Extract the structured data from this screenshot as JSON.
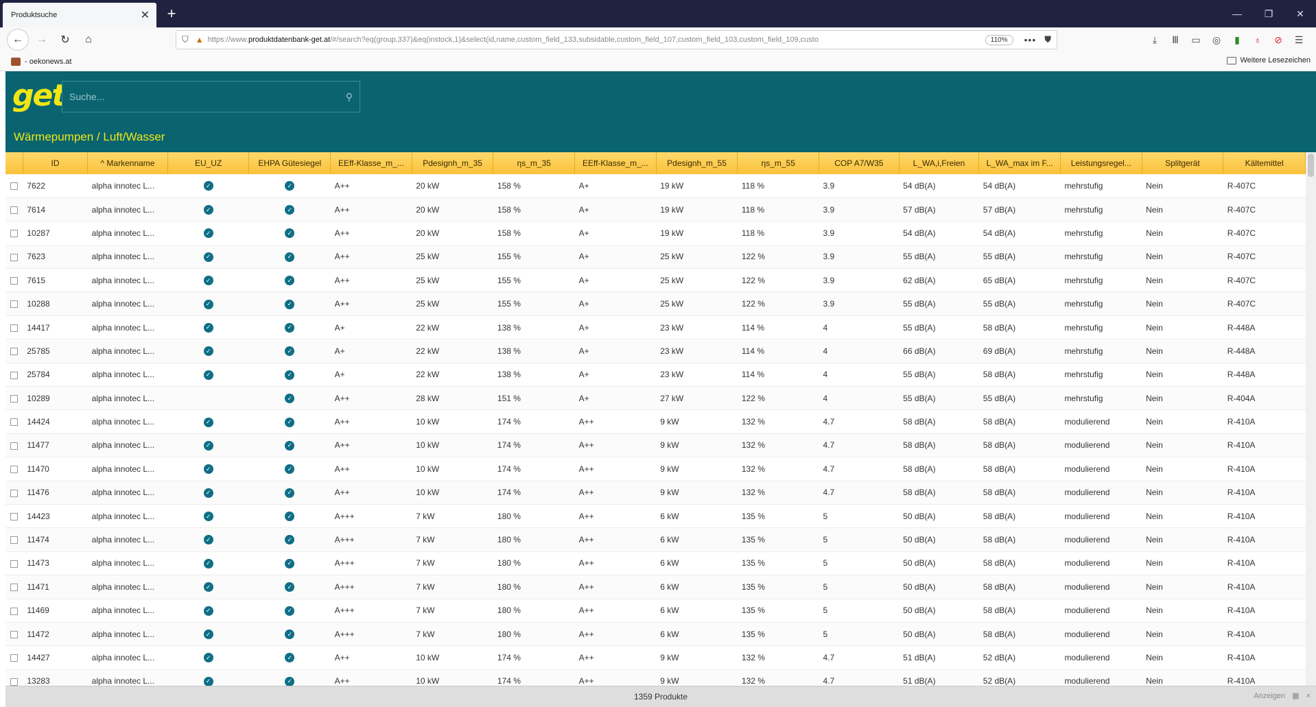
{
  "browser": {
    "tab_title": "Produktsuche",
    "tab_close": "✕",
    "new_tab": "+",
    "window_controls": [
      "—",
      "❐",
      "✕"
    ],
    "url_prefix": "https://www.",
    "url_domain": "produktdatenbank-get.at",
    "url_rest": "/#/search?eq(group,337)&eq(instock,1)&select(id,name,custom_field_133,subsidable,custom_field_107,custom_field_103,custom_field_109,custo",
    "zoom": "110%",
    "more": "•••",
    "bookmark_left": "- oekonews.at",
    "bookmark_right": "Weitere Lesezeichen"
  },
  "app": {
    "logo": "get",
    "search_placeholder": "Suche...",
    "breadcrumb": "Wärmepumpen / Luft/Wasser"
  },
  "table": {
    "columns": [
      "ID",
      "^ Markenname",
      "EU_UZ",
      "EHPA Gütesiegel",
      "EEff-Klasse_m_...",
      "Pdesignh_m_35",
      "ηs_m_35",
      "EEff-Klasse_m_...",
      "Pdesignh_m_55",
      "ηs_m_55",
      "COP A7/W35",
      "L_WA,i,Freien",
      "L_WA_max im F...",
      "Leistungsregel...",
      "Splitgerät",
      "Kältemittel"
    ],
    "rows": [
      {
        "id": "7622",
        "brand": "alpha innotec L...",
        "eu_uz": true,
        "ehpa": true,
        "eff35": "A++",
        "p35": "20 kW",
        "eta35": "158 %",
        "eff55": "A+",
        "p55": "19 kW",
        "eta55": "118 %",
        "cop": "3.9",
        "lwa": "54 dB(A)",
        "lwamax": "54 dB(A)",
        "reg": "mehrstufig",
        "split": "Nein",
        "ref": "R-407C"
      },
      {
        "id": "7614",
        "brand": "alpha innotec L...",
        "eu_uz": true,
        "ehpa": true,
        "eff35": "A++",
        "p35": "20 kW",
        "eta35": "158 %",
        "eff55": "A+",
        "p55": "19 kW",
        "eta55": "118 %",
        "cop": "3.9",
        "lwa": "57 dB(A)",
        "lwamax": "57 dB(A)",
        "reg": "mehrstufig",
        "split": "Nein",
        "ref": "R-407C"
      },
      {
        "id": "10287",
        "brand": "alpha innotec L...",
        "eu_uz": true,
        "ehpa": true,
        "eff35": "A++",
        "p35": "20 kW",
        "eta35": "158 %",
        "eff55": "A+",
        "p55": "19 kW",
        "eta55": "118 %",
        "cop": "3.9",
        "lwa": "54 dB(A)",
        "lwamax": "54 dB(A)",
        "reg": "mehrstufig",
        "split": "Nein",
        "ref": "R-407C"
      },
      {
        "id": "7623",
        "brand": "alpha innotec L...",
        "eu_uz": true,
        "ehpa": true,
        "eff35": "A++",
        "p35": "25 kW",
        "eta35": "155 %",
        "eff55": "A+",
        "p55": "25 kW",
        "eta55": "122 %",
        "cop": "3.9",
        "lwa": "55 dB(A)",
        "lwamax": "55 dB(A)",
        "reg": "mehrstufig",
        "split": "Nein",
        "ref": "R-407C"
      },
      {
        "id": "7615",
        "brand": "alpha innotec L...",
        "eu_uz": true,
        "ehpa": true,
        "eff35": "A++",
        "p35": "25 kW",
        "eta35": "155 %",
        "eff55": "A+",
        "p55": "25 kW",
        "eta55": "122 %",
        "cop": "3.9",
        "lwa": "62 dB(A)",
        "lwamax": "65 dB(A)",
        "reg": "mehrstufig",
        "split": "Nein",
        "ref": "R-407C"
      },
      {
        "id": "10288",
        "brand": "alpha innotec L...",
        "eu_uz": true,
        "ehpa": true,
        "eff35": "A++",
        "p35": "25 kW",
        "eta35": "155 %",
        "eff55": "A+",
        "p55": "25 kW",
        "eta55": "122 %",
        "cop": "3.9",
        "lwa": "55 dB(A)",
        "lwamax": "55 dB(A)",
        "reg": "mehrstufig",
        "split": "Nein",
        "ref": "R-407C"
      },
      {
        "id": "14417",
        "brand": "alpha innotec L...",
        "eu_uz": true,
        "ehpa": true,
        "eff35": "A+",
        "p35": "22 kW",
        "eta35": "138 %",
        "eff55": "A+",
        "p55": "23 kW",
        "eta55": "114 %",
        "cop": "4",
        "lwa": "55 dB(A)",
        "lwamax": "58 dB(A)",
        "reg": "mehrstufig",
        "split": "Nein",
        "ref": "R-448A"
      },
      {
        "id": "25785",
        "brand": "alpha innotec L...",
        "eu_uz": true,
        "ehpa": true,
        "eff35": "A+",
        "p35": "22 kW",
        "eta35": "138 %",
        "eff55": "A+",
        "p55": "23 kW",
        "eta55": "114 %",
        "cop": "4",
        "lwa": "66 dB(A)",
        "lwamax": "69 dB(A)",
        "reg": "mehrstufig",
        "split": "Nein",
        "ref": "R-448A"
      },
      {
        "id": "25784",
        "brand": "alpha innotec L...",
        "eu_uz": true,
        "ehpa": true,
        "eff35": "A+",
        "p35": "22 kW",
        "eta35": "138 %",
        "eff55": "A+",
        "p55": "23 kW",
        "eta55": "114 %",
        "cop": "4",
        "lwa": "55 dB(A)",
        "lwamax": "58 dB(A)",
        "reg": "mehrstufig",
        "split": "Nein",
        "ref": "R-448A"
      },
      {
        "id": "10289",
        "brand": "alpha innotec L...",
        "eu_uz": false,
        "ehpa": true,
        "eff35": "A++",
        "p35": "28 kW",
        "eta35": "151 %",
        "eff55": "A+",
        "p55": "27 kW",
        "eta55": "122 %",
        "cop": "4",
        "lwa": "55 dB(A)",
        "lwamax": "55 dB(A)",
        "reg": "mehrstufig",
        "split": "Nein",
        "ref": "R-404A"
      },
      {
        "id": "14424",
        "brand": "alpha innotec L...",
        "eu_uz": true,
        "ehpa": true,
        "eff35": "A++",
        "p35": "10 kW",
        "eta35": "174 %",
        "eff55": "A++",
        "p55": "9 kW",
        "eta55": "132 %",
        "cop": "4.7",
        "lwa": "58 dB(A)",
        "lwamax": "58 dB(A)",
        "reg": "modulierend",
        "split": "Nein",
        "ref": "R-410A"
      },
      {
        "id": "11477",
        "brand": "alpha innotec L...",
        "eu_uz": true,
        "ehpa": true,
        "eff35": "A++",
        "p35": "10 kW",
        "eta35": "174 %",
        "eff55": "A++",
        "p55": "9 kW",
        "eta55": "132 %",
        "cop": "4.7",
        "lwa": "58 dB(A)",
        "lwamax": "58 dB(A)",
        "reg": "modulierend",
        "split": "Nein",
        "ref": "R-410A"
      },
      {
        "id": "11470",
        "brand": "alpha innotec L...",
        "eu_uz": true,
        "ehpa": true,
        "eff35": "A++",
        "p35": "10 kW",
        "eta35": "174 %",
        "eff55": "A++",
        "p55": "9 kW",
        "eta55": "132 %",
        "cop": "4.7",
        "lwa": "58 dB(A)",
        "lwamax": "58 dB(A)",
        "reg": "modulierend",
        "split": "Nein",
        "ref": "R-410A"
      },
      {
        "id": "11476",
        "brand": "alpha innotec L...",
        "eu_uz": true,
        "ehpa": true,
        "eff35": "A++",
        "p35": "10 kW",
        "eta35": "174 %",
        "eff55": "A++",
        "p55": "9 kW",
        "eta55": "132 %",
        "cop": "4.7",
        "lwa": "58 dB(A)",
        "lwamax": "58 dB(A)",
        "reg": "modulierend",
        "split": "Nein",
        "ref": "R-410A"
      },
      {
        "id": "14423",
        "brand": "alpha innotec L...",
        "eu_uz": true,
        "ehpa": true,
        "eff35": "A+++",
        "p35": "7 kW",
        "eta35": "180 %",
        "eff55": "A++",
        "p55": "6 kW",
        "eta55": "135 %",
        "cop": "5",
        "lwa": "50 dB(A)",
        "lwamax": "58 dB(A)",
        "reg": "modulierend",
        "split": "Nein",
        "ref": "R-410A"
      },
      {
        "id": "11474",
        "brand": "alpha innotec L...",
        "eu_uz": true,
        "ehpa": true,
        "eff35": "A+++",
        "p35": "7 kW",
        "eta35": "180 %",
        "eff55": "A++",
        "p55": "6 kW",
        "eta55": "135 %",
        "cop": "5",
        "lwa": "50 dB(A)",
        "lwamax": "58 dB(A)",
        "reg": "modulierend",
        "split": "Nein",
        "ref": "R-410A"
      },
      {
        "id": "11473",
        "brand": "alpha innotec L...",
        "eu_uz": true,
        "ehpa": true,
        "eff35": "A+++",
        "p35": "7 kW",
        "eta35": "180 %",
        "eff55": "A++",
        "p55": "6 kW",
        "eta55": "135 %",
        "cop": "5",
        "lwa": "50 dB(A)",
        "lwamax": "58 dB(A)",
        "reg": "modulierend",
        "split": "Nein",
        "ref": "R-410A"
      },
      {
        "id": "11471",
        "brand": "alpha innotec L...",
        "eu_uz": true,
        "ehpa": true,
        "eff35": "A+++",
        "p35": "7 kW",
        "eta35": "180 %",
        "eff55": "A++",
        "p55": "6 kW",
        "eta55": "135 %",
        "cop": "5",
        "lwa": "50 dB(A)",
        "lwamax": "58 dB(A)",
        "reg": "modulierend",
        "split": "Nein",
        "ref": "R-410A"
      },
      {
        "id": "11469",
        "brand": "alpha innotec L...",
        "eu_uz": true,
        "ehpa": true,
        "eff35": "A+++",
        "p35": "7 kW",
        "eta35": "180 %",
        "eff55": "A++",
        "p55": "6 kW",
        "eta55": "135 %",
        "cop": "5",
        "lwa": "50 dB(A)",
        "lwamax": "58 dB(A)",
        "reg": "modulierend",
        "split": "Nein",
        "ref": "R-410A"
      },
      {
        "id": "11472",
        "brand": "alpha innotec L...",
        "eu_uz": true,
        "ehpa": true,
        "eff35": "A+++",
        "p35": "7 kW",
        "eta35": "180 %",
        "eff55": "A++",
        "p55": "6 kW",
        "eta55": "135 %",
        "cop": "5",
        "lwa": "50 dB(A)",
        "lwamax": "58 dB(A)",
        "reg": "modulierend",
        "split": "Nein",
        "ref": "R-410A"
      },
      {
        "id": "14427",
        "brand": "alpha innotec L...",
        "eu_uz": true,
        "ehpa": true,
        "eff35": "A++",
        "p35": "10 kW",
        "eta35": "174 %",
        "eff55": "A++",
        "p55": "9 kW",
        "eta55": "132 %",
        "cop": "4.7",
        "lwa": "51 dB(A)",
        "lwamax": "52 dB(A)",
        "reg": "modulierend",
        "split": "Nein",
        "ref": "R-410A"
      },
      {
        "id": "13283",
        "brand": "alpha innotec L...",
        "eu_uz": true,
        "ehpa": true,
        "eff35": "A++",
        "p35": "10 kW",
        "eta35": "174 %",
        "eff55": "A++",
        "p55": "9 kW",
        "eta55": "132 %",
        "cop": "4.7",
        "lwa": "51 dB(A)",
        "lwamax": "52 dB(A)",
        "reg": "modulierend",
        "split": "Nein",
        "ref": "R-410A"
      }
    ]
  },
  "footer": {
    "count": "1359 Produkte",
    "show_label": "Anzeigen"
  },
  "colors": {
    "header_bg": "#0a6470",
    "accent_yellow": "#f0e614",
    "table_header": "#f9c23c",
    "check_badge": "#0e6f86"
  }
}
